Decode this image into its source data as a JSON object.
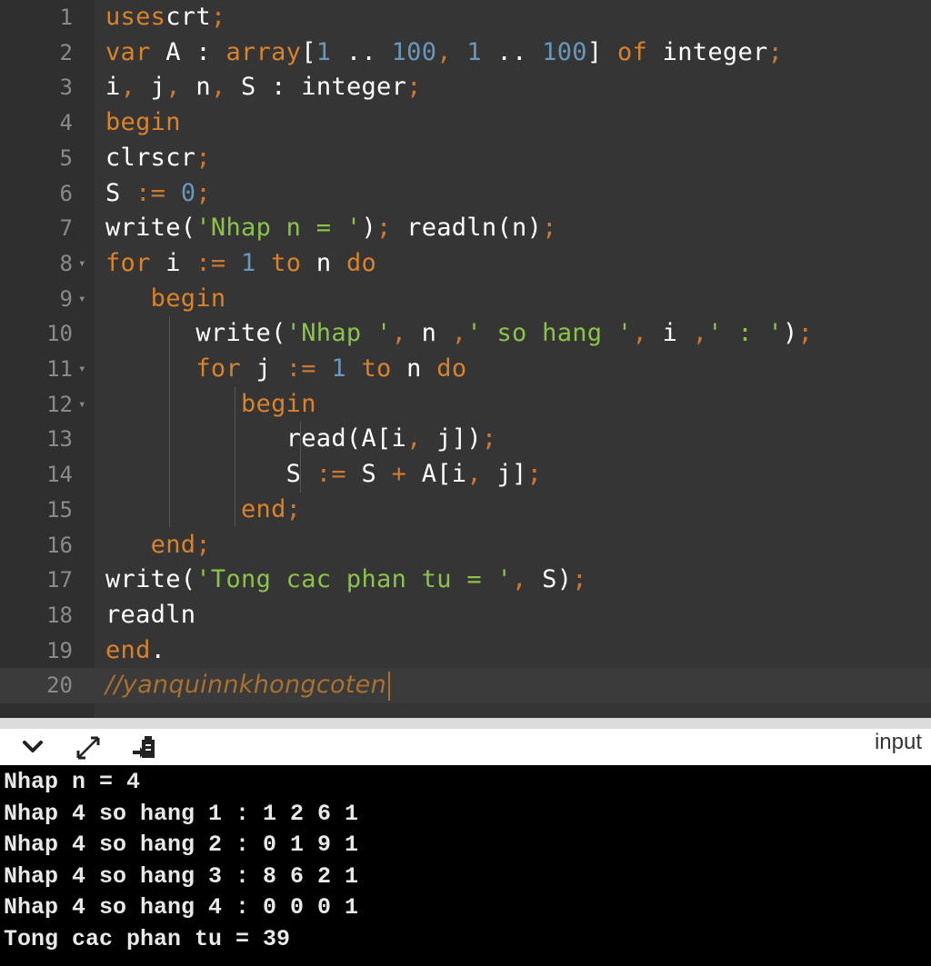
{
  "editor": {
    "lines": [
      {
        "n": "1",
        "tokens": [
          [
            "kw",
            "uses"
          ],
          [
            "",
            "crt"
          ],
          [
            "op",
            ";"
          ]
        ]
      },
      {
        "n": "2",
        "tokens": [
          [
            "kw",
            "var"
          ],
          [
            "",
            " A : "
          ],
          [
            "kw",
            "array"
          ],
          [
            "",
            "["
          ],
          [
            "num",
            "1"
          ],
          [
            "",
            " .. "
          ],
          [
            "num",
            "100"
          ],
          [
            "op",
            ","
          ],
          [
            "",
            " "
          ],
          [
            "num",
            "1"
          ],
          [
            "",
            " .. "
          ],
          [
            "num",
            "100"
          ],
          [
            "",
            "] "
          ],
          [
            "kw",
            "of"
          ],
          [
            "",
            " integer"
          ],
          [
            "op",
            ";"
          ]
        ]
      },
      {
        "n": "3",
        "tokens": [
          [
            "",
            "i"
          ],
          [
            "op",
            ","
          ],
          [
            "",
            " j"
          ],
          [
            "op",
            ","
          ],
          [
            "",
            " n"
          ],
          [
            "op",
            ","
          ],
          [
            "",
            " S : integer"
          ],
          [
            "op",
            ";"
          ]
        ]
      },
      {
        "n": "4",
        "tokens": [
          [
            "kw",
            "begin"
          ]
        ]
      },
      {
        "n": "5",
        "tokens": [
          [
            "",
            "clrscr"
          ],
          [
            "op",
            ";"
          ]
        ]
      },
      {
        "n": "6",
        "tokens": [
          [
            "",
            "S "
          ],
          [
            "op",
            ":="
          ],
          [
            "",
            " "
          ],
          [
            "num",
            "0"
          ],
          [
            "op",
            ";"
          ]
        ]
      },
      {
        "n": "7",
        "tokens": [
          [
            "",
            "write("
          ],
          [
            "str",
            "'Nhap n = '"
          ],
          [
            "",
            ")"
          ],
          [
            "op",
            ";"
          ],
          [
            "",
            " readln(n)"
          ],
          [
            "op",
            ";"
          ]
        ]
      },
      {
        "n": "8",
        "tokens": [
          [
            "kw",
            "for"
          ],
          [
            "",
            " i "
          ],
          [
            "op",
            ":="
          ],
          [
            "",
            " "
          ],
          [
            "num",
            "1"
          ],
          [
            "",
            " "
          ],
          [
            "kw",
            "to"
          ],
          [
            "",
            " n "
          ],
          [
            "kw",
            "do"
          ]
        ]
      },
      {
        "n": "9",
        "tokens": [
          [
            "",
            "   "
          ],
          [
            "kw",
            "begin"
          ]
        ]
      },
      {
        "n": "10",
        "tokens": [
          [
            "",
            "      write("
          ],
          [
            "str",
            "'Nhap '"
          ],
          [
            "op",
            ","
          ],
          [
            "",
            " n "
          ],
          [
            "op",
            ","
          ],
          [
            "str",
            "' so hang '"
          ],
          [
            "op",
            ","
          ],
          [
            "",
            " i "
          ],
          [
            "op",
            ","
          ],
          [
            "str",
            "' : '"
          ],
          [
            "",
            ")"
          ],
          [
            "op",
            ";"
          ]
        ]
      },
      {
        "n": "11",
        "tokens": [
          [
            "",
            "      "
          ],
          [
            "kw",
            "for"
          ],
          [
            "",
            " j "
          ],
          [
            "op",
            ":="
          ],
          [
            "",
            " "
          ],
          [
            "num",
            "1"
          ],
          [
            "",
            " "
          ],
          [
            "kw",
            "to"
          ],
          [
            "",
            " n "
          ],
          [
            "kw",
            "do"
          ]
        ]
      },
      {
        "n": "12",
        "tokens": [
          [
            "",
            "         "
          ],
          [
            "kw",
            "begin"
          ]
        ]
      },
      {
        "n": "13",
        "tokens": [
          [
            "",
            "            read(A[i"
          ],
          [
            "op",
            ","
          ],
          [
            "",
            " j])"
          ],
          [
            "op",
            ";"
          ]
        ]
      },
      {
        "n": "14",
        "tokens": [
          [
            "",
            "            S "
          ],
          [
            "op",
            ":="
          ],
          [
            "",
            " S "
          ],
          [
            "op",
            "+"
          ],
          [
            "",
            " A[i"
          ],
          [
            "op",
            ","
          ],
          [
            "",
            " j]"
          ],
          [
            "op",
            ";"
          ]
        ]
      },
      {
        "n": "15",
        "tokens": [
          [
            "",
            "         "
          ],
          [
            "kw",
            "end"
          ],
          [
            "op",
            ";"
          ]
        ]
      },
      {
        "n": "16",
        "tokens": [
          [
            "",
            "   "
          ],
          [
            "kw",
            "end"
          ],
          [
            "op",
            ";"
          ]
        ]
      },
      {
        "n": "17",
        "tokens": [
          [
            "",
            "write("
          ],
          [
            "str",
            "'Tong cac phan tu = '"
          ],
          [
            "op",
            ","
          ],
          [
            "",
            " S)"
          ],
          [
            "op",
            ";"
          ]
        ]
      },
      {
        "n": "18",
        "tokens": [
          [
            "",
            "readln"
          ]
        ]
      },
      {
        "n": "19",
        "tokens": [
          [
            "kw",
            "end"
          ],
          [
            "",
            "."
          ]
        ]
      },
      {
        "n": "20",
        "tokens": [
          [
            "cmt",
            "//yanquinnkhongcoten"
          ]
        ]
      }
    ],
    "fold_marker": "▾"
  },
  "console_bar": {
    "collapse_icon": "chevron-down-icon",
    "expand_icon": "expand-icon",
    "clear_icon": "clear-console-icon",
    "input_label": "input"
  },
  "console": {
    "output": [
      "Nhap n = 4",
      "Nhap 4 so hang 1 : 1 2 6 1",
      "Nhap 4 so hang 2 : 0 1 9 1",
      "Nhap 4 so hang 3 : 8 6 2 1",
      "Nhap 4 so hang 4 : 0 0 0 1",
      "Tong cac phan tu = 39"
    ]
  }
}
